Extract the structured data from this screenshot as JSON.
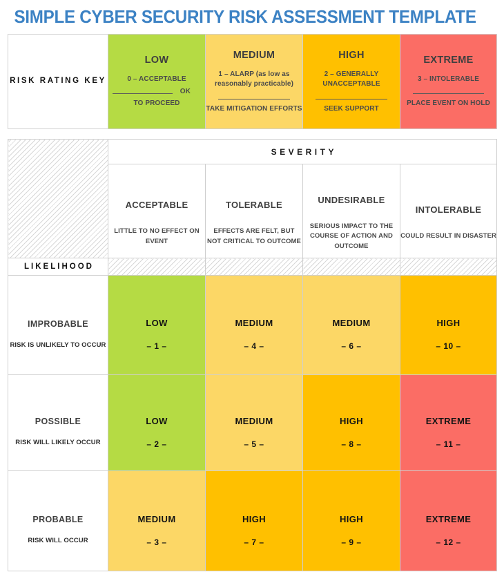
{
  "title": "SIMPLE CYBER SECURITY RISK ASSESSMENT TEMPLATE",
  "colors": {
    "title_blue": "#3C82C4",
    "low_green": "#B5DB44",
    "medium_yellow": "#FCD766",
    "high_orange": "#FFC000",
    "extreme_red": "#FB6D65",
    "border_gray": "#CFCFCF",
    "hatch_gray": "#D8D8D8"
  },
  "key": {
    "row_label": "RISK RATING KEY",
    "items": [
      {
        "level": "LOW",
        "code": "0",
        "dash": " – ",
        "descriptor": "ACCEPTABLE",
        "sub_line": "0 – ACCEPTABLE",
        "trailing_note": "OK",
        "action": "TO PROCEED",
        "color": "#B5DB44"
      },
      {
        "level": "MEDIUM",
        "code": "1",
        "dash": " – ",
        "descriptor": "ALARP (as low as reasonably practicable)",
        "sub_line": "1 – ALARP (as low as reasonably practicable)",
        "trailing_note": "",
        "action": "TAKE MITIGATION EFFORTS",
        "color": "#FCD766"
      },
      {
        "level": "HIGH",
        "code": "2",
        "dash": " – ",
        "descriptor": "GENERALLY UNACCEPTABLE",
        "sub_line": "2 – GENERALLY UNACCEPTABLE",
        "trailing_note": "",
        "action": "SEEK SUPPORT",
        "color": "#FFC000"
      },
      {
        "level": "EXTREME",
        "code": "3",
        "dash": " – ",
        "descriptor": "INTOLERABLE",
        "sub_line": "3 – INTOLERABLE",
        "trailing_note": "",
        "action": "PLACE EVENT ON HOLD",
        "color": "#FB6D65"
      }
    ]
  },
  "matrix": {
    "severity_banner": "SEVERITY",
    "likelihood_label": "LIKELIHOOD",
    "severity_columns": [
      {
        "name": "ACCEPTABLE",
        "description": "LITTLE TO NO EFFECT ON EVENT"
      },
      {
        "name": "TOLERABLE",
        "description": "EFFECTS ARE FELT, BUT NOT CRITICAL TO OUTCOME"
      },
      {
        "name": "UNDESIRABLE",
        "description": "SERIOUS IMPACT TO THE COURSE OF ACTION AND OUTCOME"
      },
      {
        "name": "INTOLERABLE",
        "description": "COULD RESULT IN DISASTER"
      }
    ],
    "rows": [
      {
        "name": "IMPROBABLE",
        "description": "RISK IS UNLIKELY TO OCCUR",
        "cells": [
          {
            "label": "LOW",
            "number": "– 1 –",
            "color": "#B5DB44"
          },
          {
            "label": "MEDIUM",
            "number": "– 4 –",
            "color": "#FCD766"
          },
          {
            "label": "MEDIUM",
            "number": "– 6 –",
            "color": "#FCD766"
          },
          {
            "label": "HIGH",
            "number": "– 10 –",
            "color": "#FFC000"
          }
        ]
      },
      {
        "name": "POSSIBLE",
        "description": "RISK WILL LIKELY OCCUR",
        "cells": [
          {
            "label": "LOW",
            "number": "– 2 –",
            "color": "#B5DB44"
          },
          {
            "label": "MEDIUM",
            "number": "– 5 –",
            "color": "#FCD766"
          },
          {
            "label": "HIGH",
            "number": "– 8 –",
            "color": "#FFC000"
          },
          {
            "label": "EXTREME",
            "number": "– 11 –",
            "color": "#FB6D65"
          }
        ]
      },
      {
        "name": "PROBABLE",
        "description": "RISK WILL OCCUR",
        "cells": [
          {
            "label": "MEDIUM",
            "number": "– 3 –",
            "color": "#FCD766"
          },
          {
            "label": "HIGH",
            "number": "– 7 –",
            "color": "#FFC000"
          },
          {
            "label": "HIGH",
            "number": "– 9 –",
            "color": "#FFC000"
          },
          {
            "label": "EXTREME",
            "number": "– 12 –",
            "color": "#FB6D65"
          }
        ]
      }
    ]
  }
}
